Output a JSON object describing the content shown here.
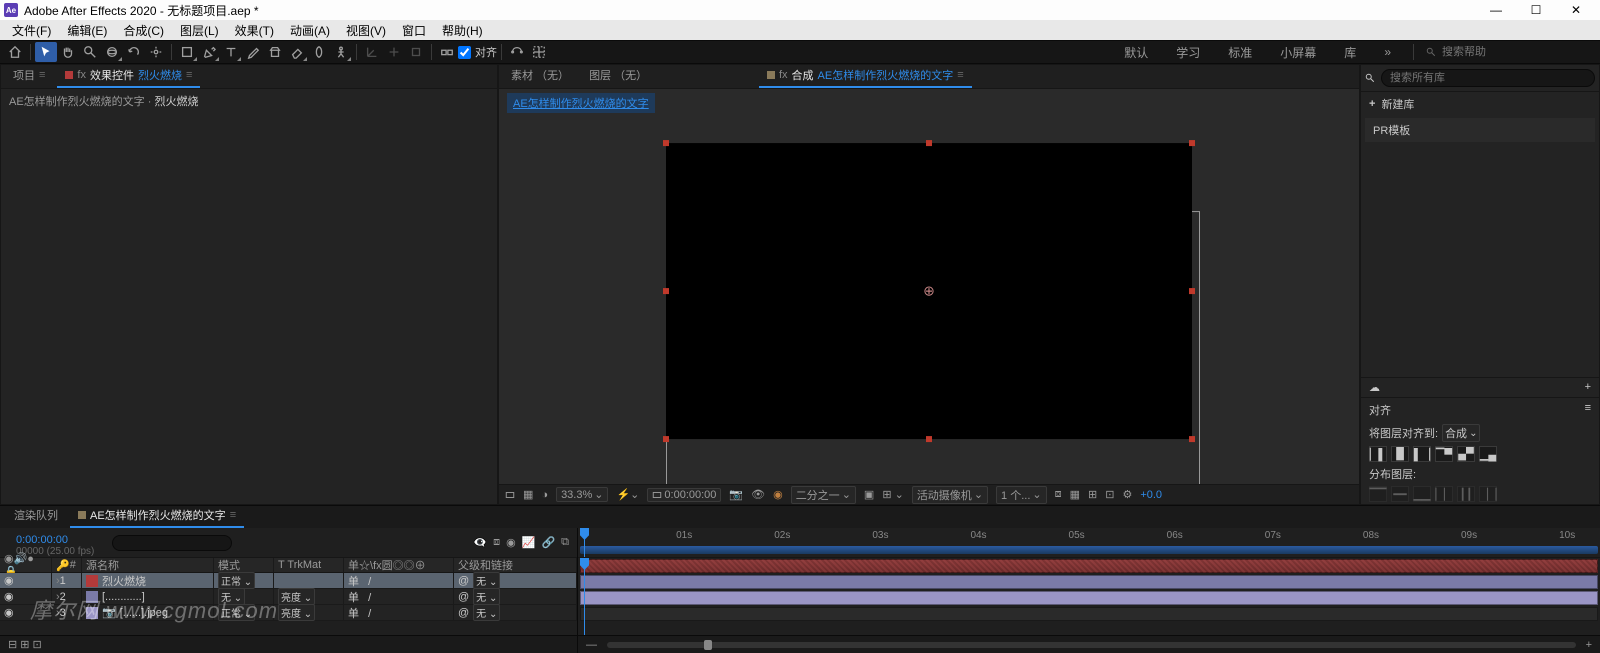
{
  "title": "Adobe After Effects 2020 - 无标题项目.aep *",
  "menu": [
    "文件(F)",
    "编辑(E)",
    "合成(C)",
    "图层(L)",
    "效果(T)",
    "动画(A)",
    "视图(V)",
    "窗口",
    "帮助(H)"
  ],
  "toolbar": {
    "snap_label": "对齐"
  },
  "workspaces": [
    "默认",
    "学习",
    "标准",
    "小屏幕",
    "库"
  ],
  "search_help_placeholder": "搜索帮助",
  "project": {
    "tabs": {
      "project": "项目",
      "fx": "效果控件",
      "fx_target": "烈火燃烧"
    },
    "crumb_comp": "AE怎样制作烈火燃烧的文字",
    "crumb_layer": "烈火燃烧"
  },
  "center": {
    "tabs": {
      "footage": "素材 （无）",
      "layer": "图层 （无）",
      "comp_prefix": "合成",
      "comp_name": "AE怎样制作烈火燃烧的文字"
    },
    "link_text": "AE怎样制作烈火燃烧的文字",
    "footer": {
      "zoom": "33.3%",
      "res": "二分之一",
      "camera": "活动摄像机",
      "view": "1 个...",
      "tc": "0:00:00:00",
      "exposure": "+0.0"
    }
  },
  "library": {
    "search_placeholder": "搜索所有库",
    "new_lib": "新建库",
    "items": [
      "PR模板"
    ],
    "align_title": "对齐",
    "align_to_label": "将图层对齐到:",
    "align_to_value": "合成",
    "distribute_label": "分布图层:"
  },
  "timeline": {
    "tabs": {
      "render": "渲染队列",
      "comp": "AE怎样制作烈火燃烧的文字"
    },
    "timecode": "0:00:00:00",
    "timecode_sub": "00000 (25.00 fps)",
    "search_placeholder": "",
    "columns": {
      "num": "#",
      "source": "源名称",
      "mode": "模式",
      "trkmat": "T  TrkMat",
      "switches": "单☆\\fx圆◎◎⊕",
      "parent": "父级和链接"
    },
    "layers": [
      {
        "num": "1",
        "color": "#b33a3a",
        "name": "烈火燃烧",
        "mode": "正常",
        "trk": "",
        "parent": "无",
        "selected": true
      },
      {
        "num": "2",
        "color": "#7a7aa8",
        "name": "[............]",
        "mode": "无",
        "trk": "亮度",
        "parent": "无",
        "selected": false
      },
      {
        "num": "3",
        "color": "#9a95c5",
        "name": "[......].jpeg",
        "mode": "正常",
        "trk": "亮度",
        "parent": "无",
        "selected": false
      }
    ],
    "ruler": [
      "01s",
      "02s",
      "03s",
      "04s",
      "05s",
      "06s",
      "07s",
      "08s",
      "09s",
      "10s"
    ]
  },
  "watermark": "摩尔网  www.cgmol.com"
}
